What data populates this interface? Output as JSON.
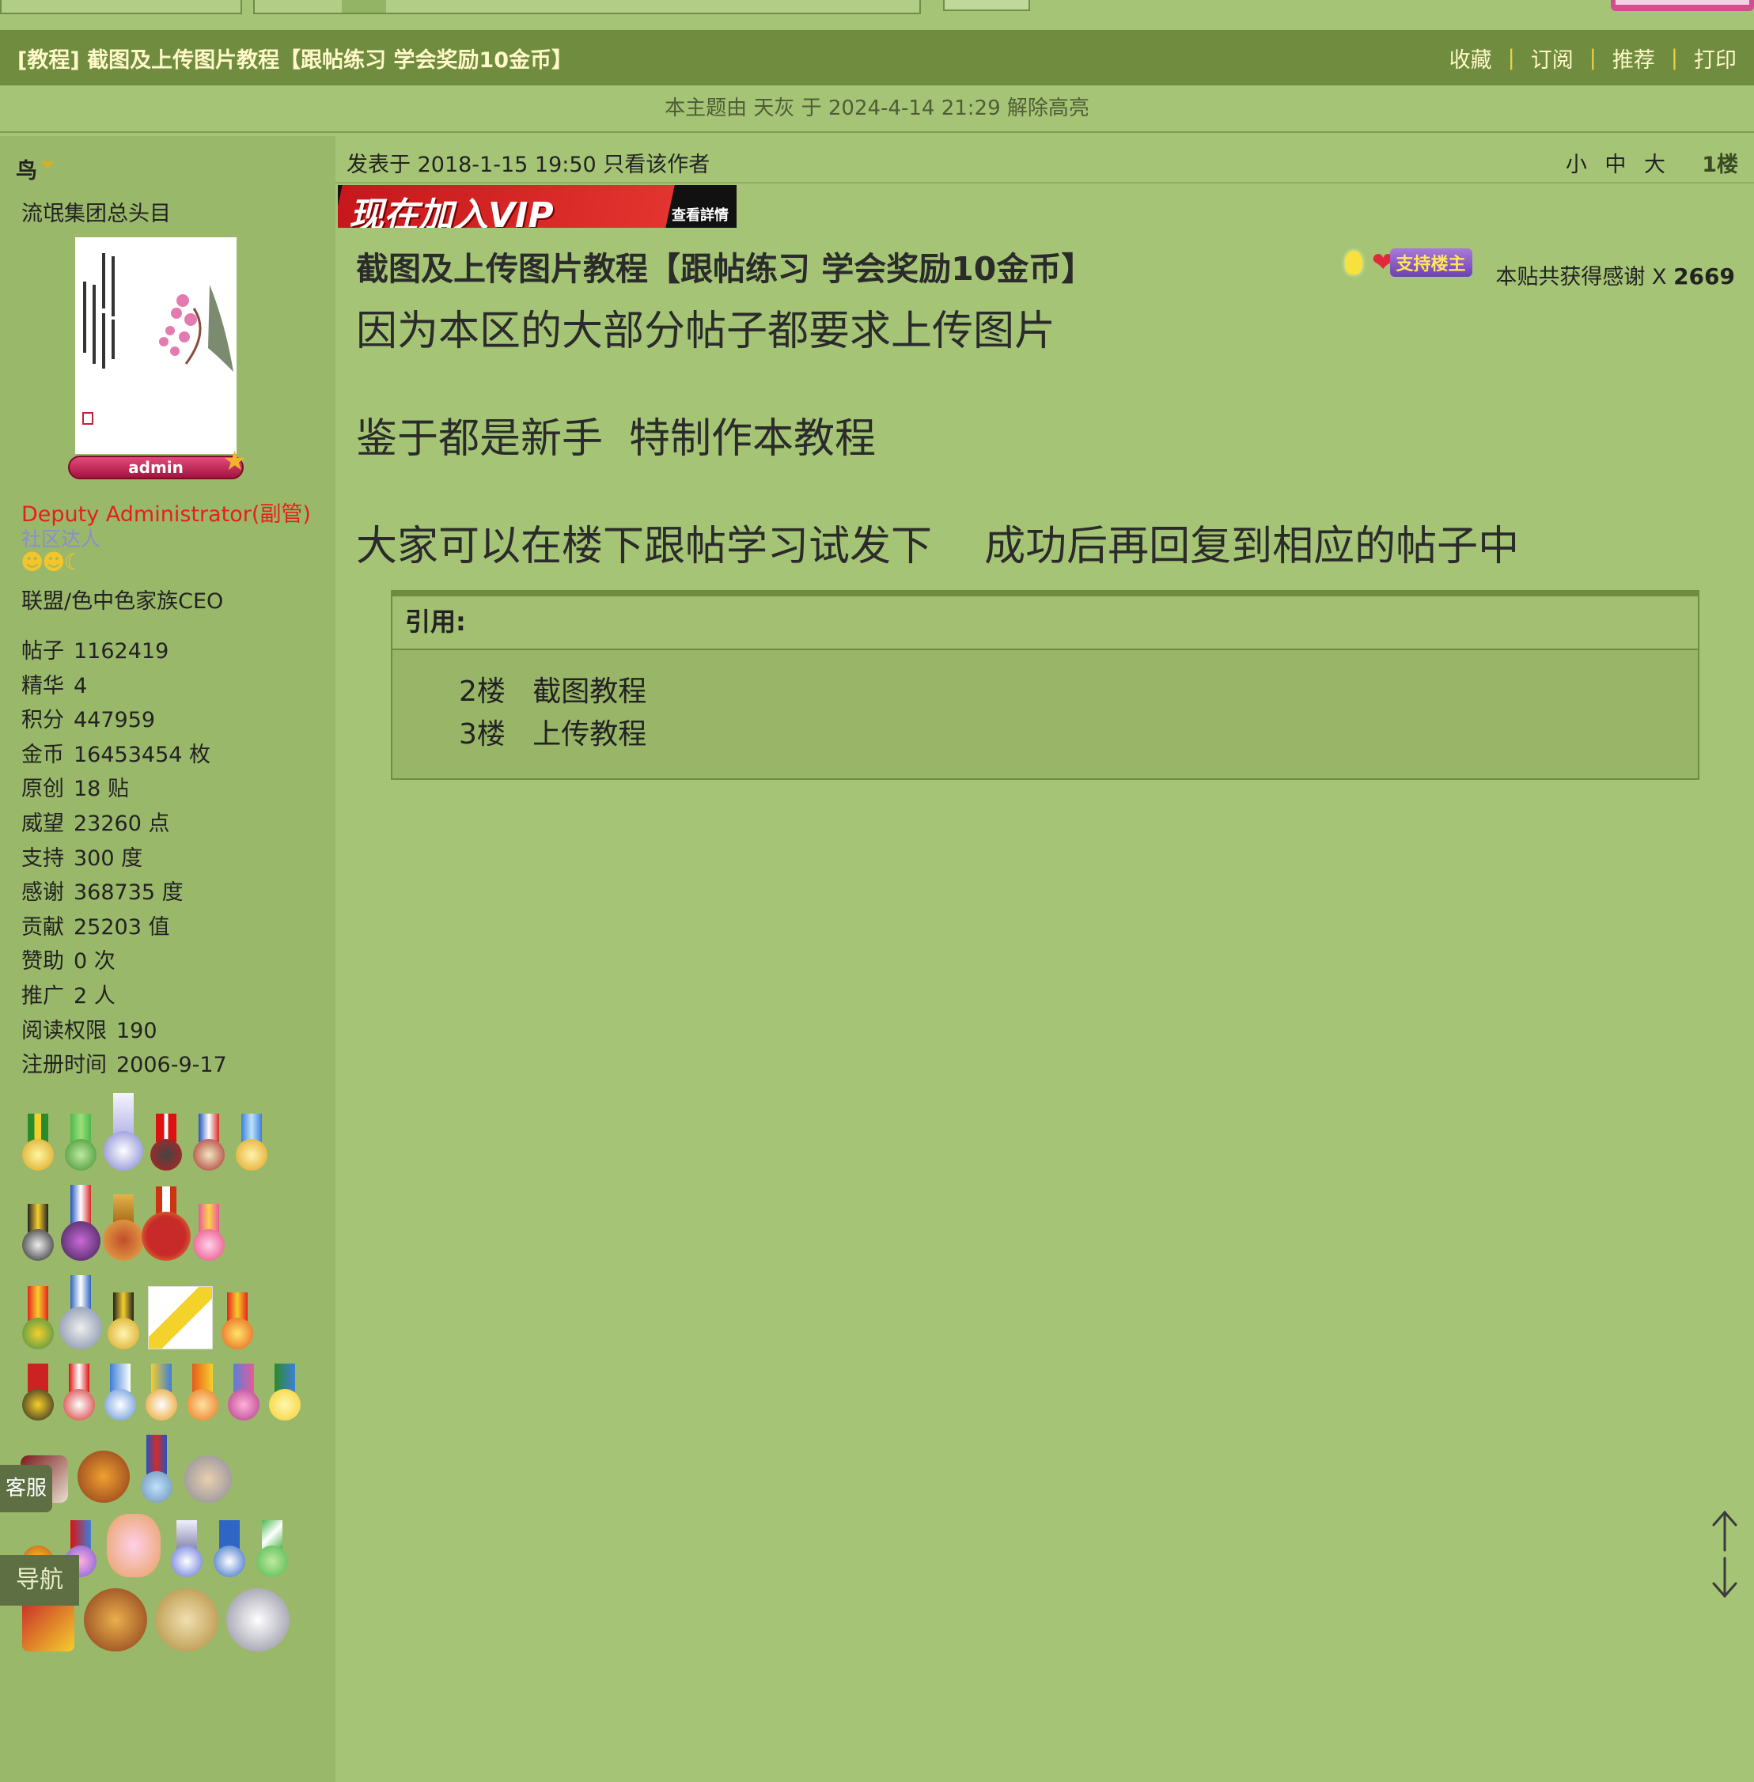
{
  "thread": {
    "title": "[教程] 截图及上传图片教程【跟帖练习 学会奖励10金币】",
    "actions": [
      "收藏",
      "订阅",
      "推荐",
      "打印"
    ],
    "notice": "本主题由 天灰 于 2024-4-14 21:29 解除高亮"
  },
  "author": {
    "name": "鸟",
    "title": "流氓集团总头目",
    "badge": "admin",
    "group": "Deputy Administrator(副管)",
    "rank": "社区达人",
    "affiliation": "联盟/色中色家族CEO",
    "stats": [
      {
        "label": "帖子",
        "value": "1162419"
      },
      {
        "label": "精华",
        "value": "4"
      },
      {
        "label": "积分",
        "value": "447959"
      },
      {
        "label": "金币",
        "value": "16453454 枚"
      },
      {
        "label": "原创",
        "value": "18 贴"
      },
      {
        "label": "威望",
        "value": "23260 点"
      },
      {
        "label": "支持",
        "value": "300 度"
      },
      {
        "label": "感谢",
        "value": "368735 度"
      },
      {
        "label": "贡献",
        "value": "25203 值"
      },
      {
        "label": "赞助",
        "value": "0 次"
      },
      {
        "label": "推广",
        "value": "2 人"
      },
      {
        "label": "阅读权限",
        "value": "190"
      },
      {
        "label": "注册时间",
        "value": "2006-9-17"
      }
    ]
  },
  "post": {
    "meta": "发表于 2018-1-15 19:50  只看该作者",
    "font_sizes": [
      "小",
      "中",
      "大"
    ],
    "floor": "1楼",
    "vip_banner": "现在加入VIP",
    "vip_banner_sub": "查看詳情",
    "title": "截图及上传图片教程【跟帖练习 学会奖励10金币】",
    "support_tag": "支持楼主",
    "thanks_label": "本贴共获得感谢 X",
    "thanks_count": "2669",
    "lines": [
      "因为本区的大部分帖子都要求上传图片",
      "鉴于都是新手  特制作本教程",
      "大家可以在楼下跟帖学习试发下    成功后再回复到相应的帖子中"
    ],
    "quote_label": "引用:",
    "quote_lines": [
      "2楼   截图教程",
      "3楼   上传教程"
    ]
  },
  "floating": {
    "service": "客服",
    "nav": "导航"
  },
  "colors": {
    "page_bg": "#a5c475",
    "title_bar": "#6f8c3f",
    "title_text": "#fff8c8",
    "group_red": "#e5201b",
    "rank_purple": "#8f8ad6"
  }
}
